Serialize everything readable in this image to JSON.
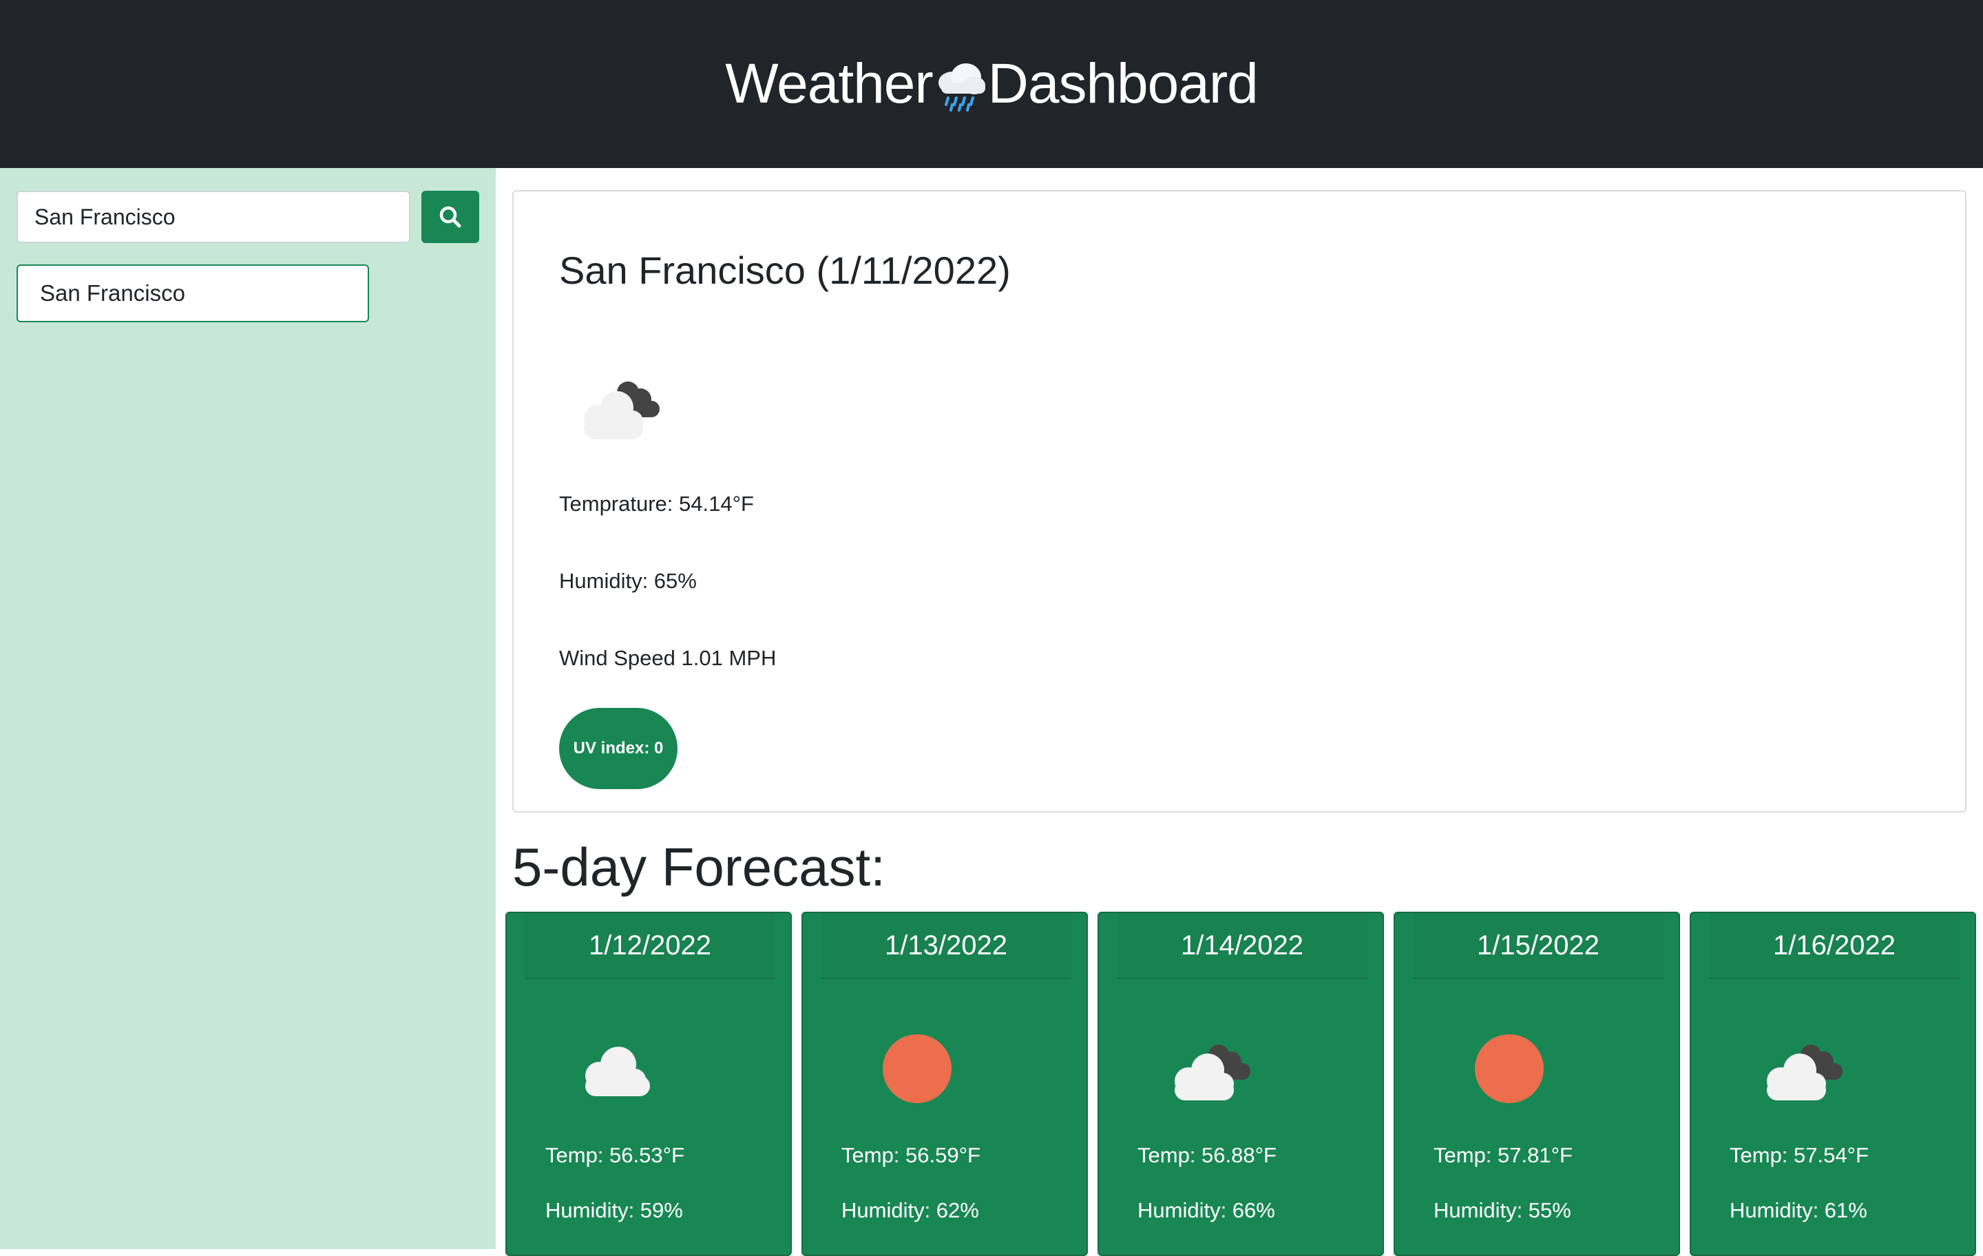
{
  "header": {
    "title_left": "Weather",
    "title_right": "Dashboard",
    "title_icon": "cloud-rain-icon"
  },
  "sidebar": {
    "search": {
      "value": "San Francisco",
      "button_icon": "search-icon"
    },
    "history": [
      "San Francisco"
    ]
  },
  "current": {
    "heading": "San Francisco (1/11/2022)",
    "icon": "broken-clouds-icon",
    "temperature": "Temprature: 54.14°F",
    "humidity": "Humidity: 65%",
    "wind": "Wind Speed 1.01 MPH",
    "uv": "UV index: 0"
  },
  "forecast": {
    "heading": "5-day Forecast:",
    "days": [
      {
        "date": "1/12/2022",
        "icon": "cloud-icon",
        "temp": "Temp: 56.53°F",
        "humidity": "Humidity: 59%"
      },
      {
        "date": "1/13/2022",
        "icon": "sun-icon",
        "temp": "Temp: 56.59°F",
        "humidity": "Humidity: 62%"
      },
      {
        "date": "1/14/2022",
        "icon": "broken-clouds-icon",
        "temp": "Temp: 56.88°F",
        "humidity": "Humidity: 66%"
      },
      {
        "date": "1/15/2022",
        "icon": "sun-icon",
        "temp": "Temp: 57.81°F",
        "humidity": "Humidity: 55%"
      },
      {
        "date": "1/16/2022",
        "icon": "broken-clouds-icon",
        "temp": "Temp: 57.54°F",
        "humidity": "Humidity: 61%"
      }
    ]
  },
  "colors": {
    "header_bg": "#212529",
    "sidebar_bg": "#c7e8d6",
    "accent_green": "#198754",
    "sun": "#ec6e4c",
    "cloud_light": "#f2f2f2",
    "cloud_dark": "#444444"
  }
}
